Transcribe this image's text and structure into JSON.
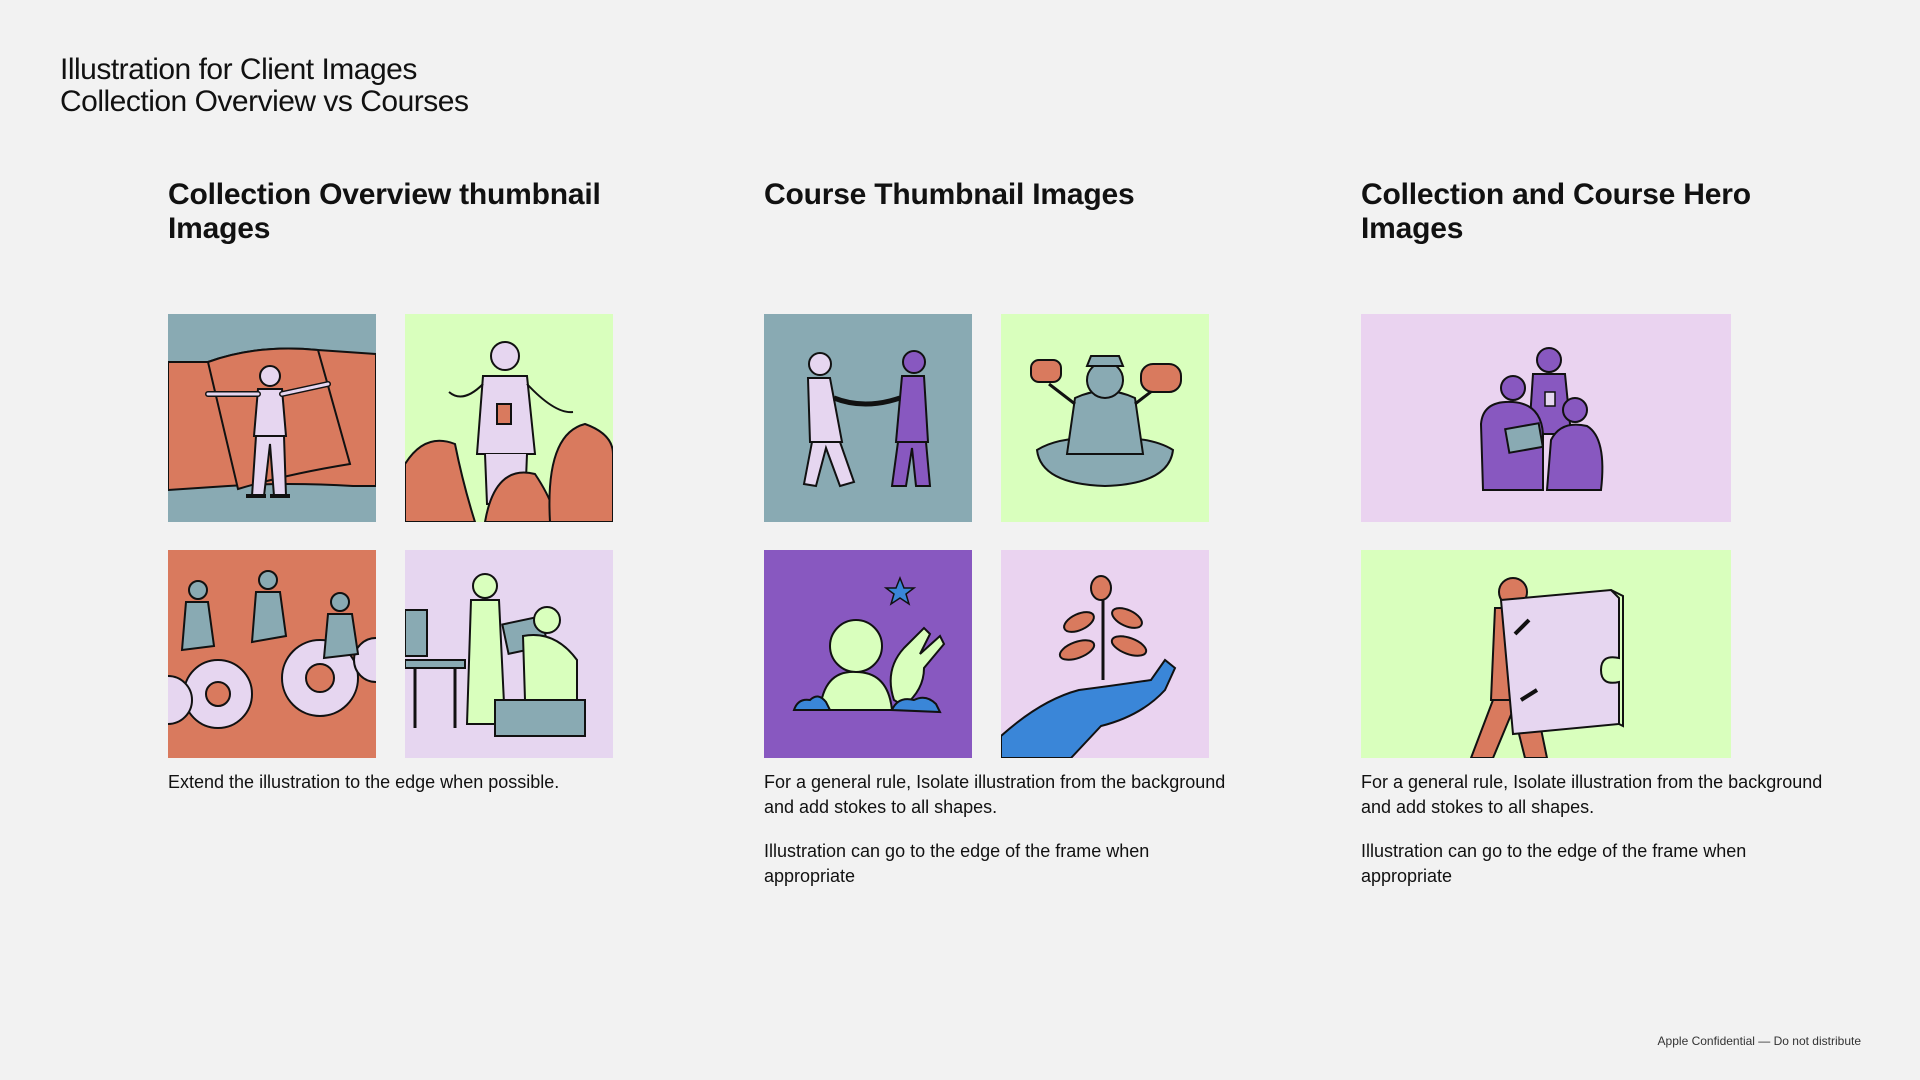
{
  "header": {
    "line1": "Illustration for Client Images",
    "line2": "Collection Overview vs Courses"
  },
  "columns": [
    {
      "title": "Collection Overview thumbnail Images",
      "paragraphs": [
        "Extend the illustration to the edge when possible."
      ]
    },
    {
      "title": "Course Thumbnail Images",
      "paragraphs": [
        "For a general rule, Isolate illustration from the background and add stokes to all shapes.",
        "Illustration can go to the edge of the frame when appropriate"
      ]
    },
    {
      "title": "Collection and Course Hero Images",
      "paragraphs": [
        "For a general rule, Isolate illustration from the background and add stokes to all shapes.",
        "Illustration can go to the edge of the frame when appropriate"
      ]
    }
  ],
  "footer": {
    "text": "Apple Confidential — Do not distribute"
  },
  "colors": {
    "background": "#f2f2f2",
    "slate": "#89aab3",
    "coral": "#d97a5e",
    "lime": "#d9ffbd",
    "lilac": "#e6d6f0",
    "purple": "#8858c0",
    "blue": "#3a86d8",
    "pink_lavender": "#ead3f0"
  },
  "icons": [
    "person-holding-banner-illustration",
    "presenter-with-audience-illustration",
    "people-on-gears-illustration",
    "coworkers-at-desk-illustration",
    "two-people-handshake-illustration",
    "seated-person-juggling-illustration",
    "person-with-star-illustration",
    "hand-holding-plant-illustration",
    "group-meeting-illustration",
    "person-carrying-puzzle-piece-illustration"
  ]
}
